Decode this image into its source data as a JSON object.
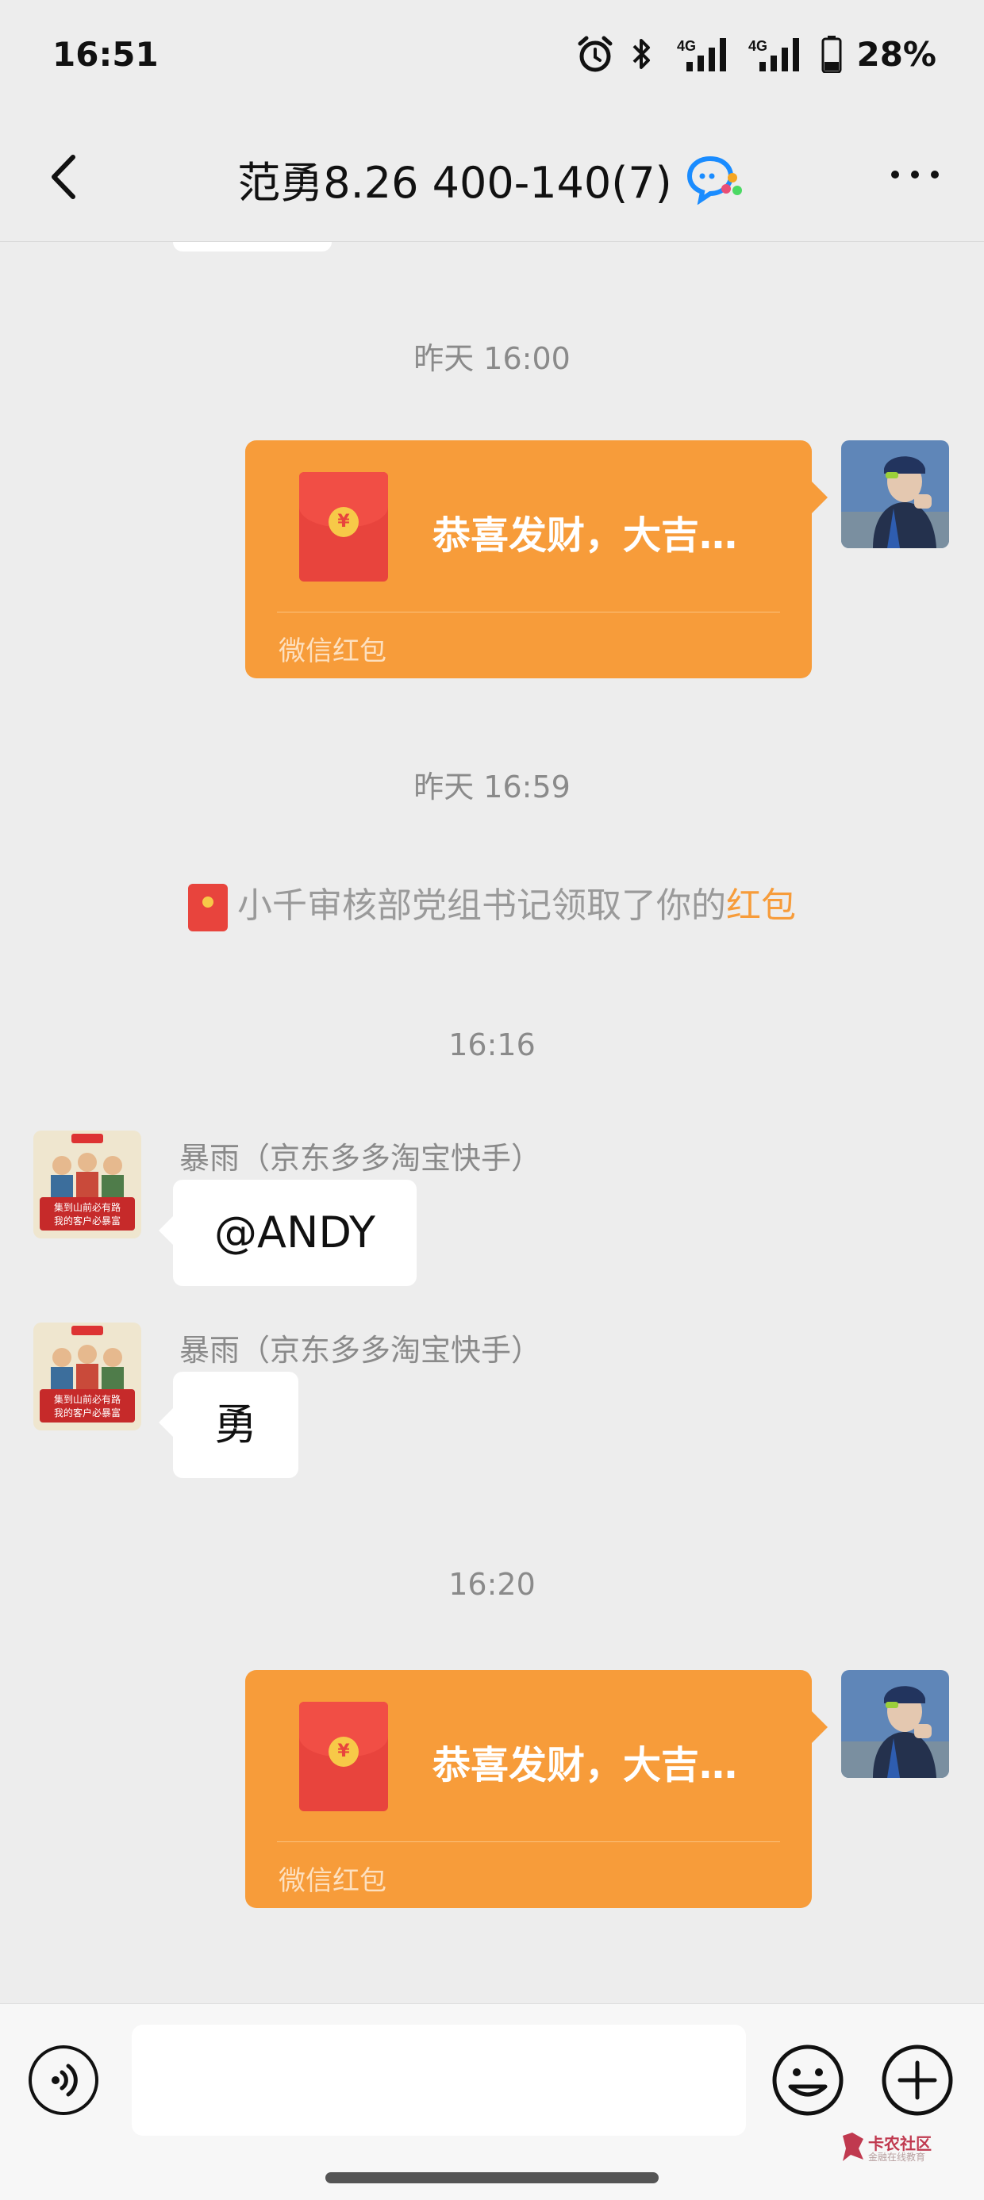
{
  "status_bar": {
    "time": "16:51",
    "network_1": "4G",
    "network_2": "4G",
    "battery": "28%"
  },
  "header": {
    "title": "范勇8.26 400-140(7)"
  },
  "messages": {
    "ts1": "昨天 16:00",
    "rp1_text": "恭喜发财，大吉…",
    "rp1_label": "微信红包",
    "ts2": "昨天 16:59",
    "system_notice_prefix": "小千审核部党组书记领取了你的",
    "system_notice_link": "红包",
    "ts3": "16:16",
    "msg1_sender": "暴雨（京东多多淘宝快手）",
    "msg1_text": "@ANDY",
    "msg2_sender": "暴雨（京东多多淘宝快手）",
    "msg2_text": "勇",
    "ts4": "16:20",
    "rp2_text": "恭喜发财，大吉…",
    "rp2_label": "微信红包"
  },
  "avatar_poster": {
    "line1": "集到山前必有路",
    "line2": "我的客户必暴富"
  },
  "watermark": {
    "name": "卡农社区",
    "sub": "金融在线教育"
  },
  "colors": {
    "red_packet": "#f79c3a",
    "link": "#f79c3a",
    "background": "#ededed"
  }
}
